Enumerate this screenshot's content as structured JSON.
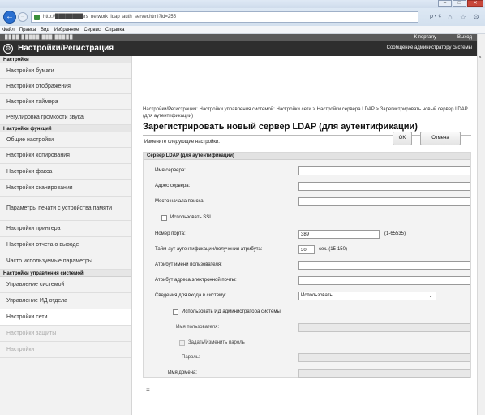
{
  "browser": {
    "url": "http://████████/rs_network_ldap_auth_server.html?id=255",
    "url_tools": "ρ • ¢",
    "window_buttons": {
      "minimize": "–",
      "maximize": "□",
      "close": "✕"
    },
    "menu": [
      "Файл",
      "Правка",
      "Вид",
      "Избранное",
      "Сервис",
      "Справка"
    ]
  },
  "header": {
    "device_info": "████ █████ ███ █████",
    "portal_link": "К порталу",
    "logout_link": "Выход",
    "title": "Настройки/Регистрация",
    "admin_message": "Сообщение администратору системы"
  },
  "sidebar": {
    "sections": [
      {
        "title": "Настройки",
        "items": [
          "Настройки бумаги",
          "Настройки отображения",
          "Настройки таймера",
          "Регулировка громкости звука"
        ]
      },
      {
        "title": "Настройки функций",
        "items": [
          "Общие настройки",
          "Настройки копирования",
          "Настройки факса",
          "Настройки сканирования",
          "Параметры печати с устройства памяти",
          "Настройки принтера",
          "Настройки отчета о выводе",
          "Часто используемые параметры"
        ]
      },
      {
        "title": "Настройки управления системой",
        "items": [
          "Управление системой",
          "Управление ИД отдела",
          "Настройки сети",
          "Настройки защиты",
          "Настройки"
        ]
      }
    ]
  },
  "main": {
    "breadcrumb": "Настройки/Регистрация: Настройки управления системой: Настройки сети > Настройки сервера LDAP > Зарегистрировать новый сервер LDAP (для аутентификации)",
    "title": "Зарегистрировать новый сервер LDAP (для аутентификации)",
    "instruction": "Измените следующие настройки.",
    "ok_label": "OK",
    "cancel_label": "Отмена",
    "bottom_mark": "≡"
  },
  "form": {
    "section_title": "Сервер LDAP (для аутентификации)",
    "server_name_label": "Имя сервера:",
    "server_name_value": "",
    "server_address_label": "Адрес сервера:",
    "server_address_value": "",
    "search_start_label": "Место начала поиска:",
    "search_start_value": "",
    "use_ssl_label": "Использовать SSL",
    "port_label": "Номер порта:",
    "port_value": "389",
    "port_range": "(1-65535)",
    "timeout_label": "Тайм-аут аутентификации/получения атрибута:",
    "timeout_value": "30",
    "timeout_unit": "сек. (15-150)",
    "username_attr_label": "Атрибут имени пользователя:",
    "username_attr_value": "",
    "email_attr_label": "Атрибут адреса электронной почты:",
    "email_attr_value": "",
    "login_info_label": "Сведения для входа в систему:",
    "login_info_value": "Использовать",
    "use_admin_id_label": "Использовать ИД администратора системы",
    "user_name_label": "Имя пользователя:",
    "set_password_label": "Задать/Изменить пароль",
    "password_label": "Пароль:",
    "domain_label": "Имя домена:"
  }
}
